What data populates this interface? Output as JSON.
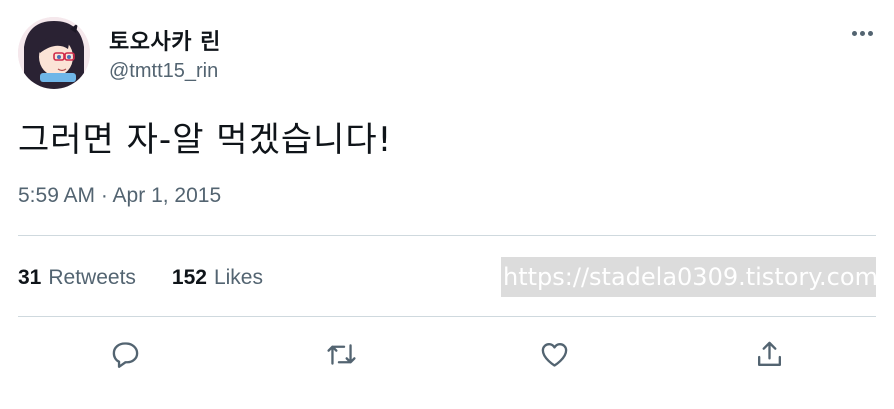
{
  "author": {
    "display_name": "토오사카 린",
    "handle": "@tmtt15_rin"
  },
  "tweet": {
    "text": "그러면 자-알 먹겠습니다!",
    "timestamp": "5:59 AM · Apr 1, 2015"
  },
  "stats": {
    "retweets_count": "31",
    "retweets_label": "Retweets",
    "likes_count": "152",
    "likes_label": "Likes"
  },
  "watermark": "https://stadela0309.tistory.com",
  "icons": {
    "more": "more-horizontal-icon",
    "reply": "reply-icon",
    "retweet": "retweet-icon",
    "like": "heart-icon",
    "share": "share-icon"
  },
  "colors": {
    "text_primary": "#0f1419",
    "text_secondary": "#536471",
    "divider": "#cfd9de"
  }
}
